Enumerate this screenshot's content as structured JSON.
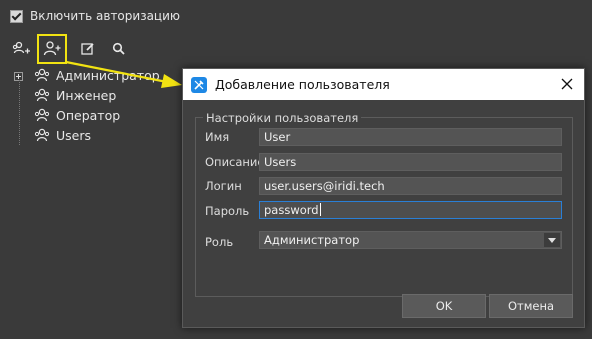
{
  "window": {
    "auth_checkbox_label": "Включить авторизацию",
    "auth_checked": true
  },
  "toolbar": {
    "buttons": [
      {
        "icon": "users-group-add-icon"
      },
      {
        "icon": "add-user-icon",
        "highlighted": true
      },
      {
        "icon": "edit-icon"
      },
      {
        "icon": "search-icon"
      }
    ],
    "highlight_color": "#f2e312"
  },
  "tree": {
    "items": [
      {
        "label": "Администратор",
        "expandable": true
      },
      {
        "label": "Инженер"
      },
      {
        "label": "Оператор"
      },
      {
        "label": "Users"
      }
    ]
  },
  "dialog": {
    "title": "Добавление пользователя",
    "group_title": "Настройки пользователя",
    "fields": {
      "name_label": "Имя",
      "name_value": "User",
      "description_label": "Описание",
      "description_value": "Users",
      "login_label": "Логин",
      "login_value": "user.users@iridi.tech",
      "password_label": "Пароль",
      "password_value": "password",
      "role_label": "Роль",
      "role_value": "Администратор"
    },
    "ok_label": "OK",
    "cancel_label": "Отмена",
    "accent_color": "#2a7fd6"
  }
}
